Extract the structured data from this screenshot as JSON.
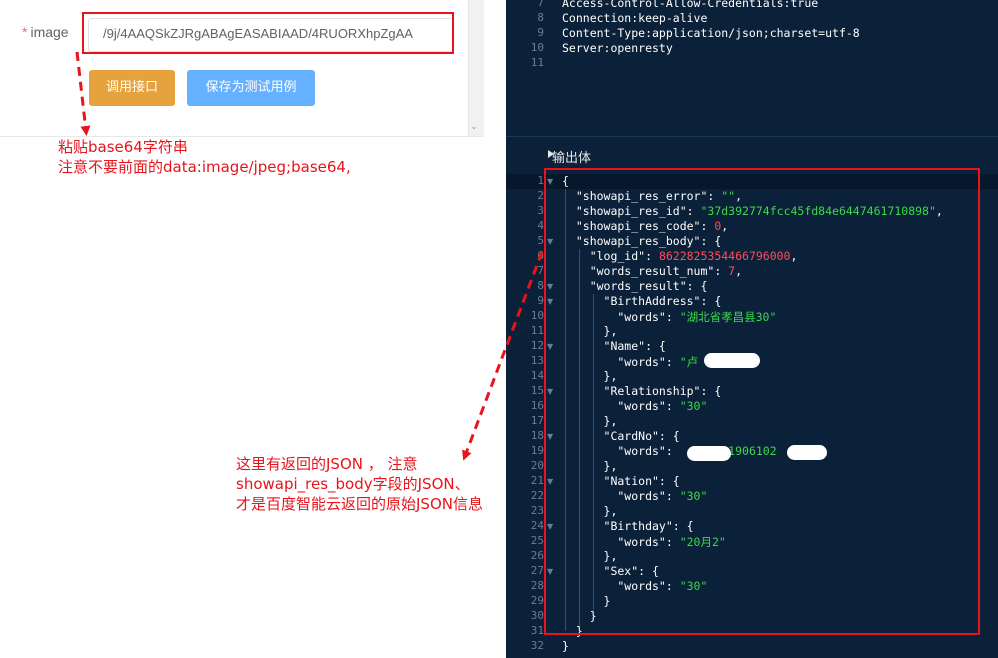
{
  "form": {
    "image_label": "image",
    "required_mark": "*",
    "image_value": "/9j/4AAQSkZJRgABAgEASABIAAD/4RUORXhpZgAA",
    "call_button": "调用接口",
    "save_button": "保存为测试用例"
  },
  "annotations": {
    "note1_line1": "粘贴base64字符串",
    "note1_line2": "注意不要前面的data:image/jpeg;base64,",
    "note2_line1": "这里有返回的JSON ， 注意",
    "note2_line2": "showapi_res_body字段的JSON、",
    "note2_line3": "才是百度智能云返回的原始JSON信息"
  },
  "headers_panel": {
    "lines": [
      {
        "no": "7",
        "text": "Access-Control-Allow-Credentials:true"
      },
      {
        "no": "8",
        "text": "Connection:keep-alive"
      },
      {
        "no": "9",
        "text": "Content-Type:application/json;charset=utf-8"
      },
      {
        "no": "10",
        "text": "Server:openresty"
      },
      {
        "no": "11",
        "text": ""
      }
    ]
  },
  "output_section": {
    "title": "输出体"
  },
  "output_json": {
    "showapi_res_error": "\"\"",
    "showapi_res_id": "\"37d392774fcc45fd84e6447461710898\"",
    "showapi_res_code": "0",
    "log_id": "8622825354466796000",
    "words_result_num": "7",
    "birth_address": "\"湖北省孝昌县30\"",
    "name_words": "\"卢",
    "relationship_words": "\"30\"",
    "cardno_words_mid": "11906102",
    "cardno_words_end": "\"",
    "nation_words": "\"30\"",
    "birthday_words": "\"20月2\"",
    "sex_words": "\"30\""
  },
  "colors": {
    "editor_bg": "#0b2039",
    "annotation_red": "#e8141b",
    "string_green": "#3bd94a",
    "number_red": "#ff4d5e",
    "btn_orange": "#e6a23c",
    "btn_blue": "#66b1ff"
  }
}
